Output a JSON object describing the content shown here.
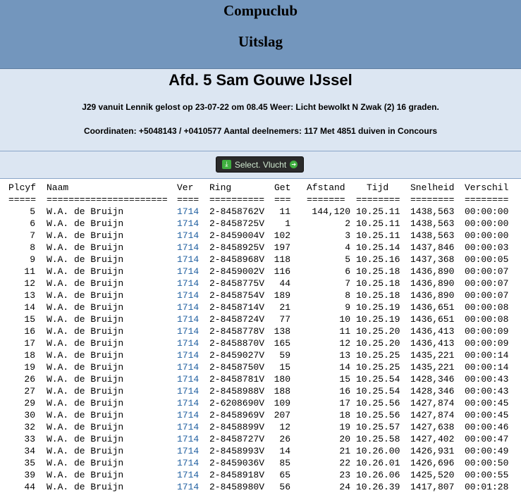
{
  "header": {
    "club": "Compuclub",
    "subtitle": "Uitslag"
  },
  "info": {
    "afdeling": "Afd. 5 Sam Gouwe IJssel",
    "line1": "J29 vanuit Lennik gelost op 23-07-22 om 08.45 Weer: Licht bewolkt N Zwak (2) 16 graden.",
    "line2": "Coordinaten: +5048143 / +0410577 Aantal deelnemers: 117 Met 4851 duiven in Concours"
  },
  "select_button": {
    "label": "Select. Vlucht"
  },
  "table": {
    "headers": {
      "plcyf": "Plcyf",
      "naam": "Naam",
      "ver": "Ver",
      "ring": "Ring",
      "get": "Get",
      "afstand": "Afstand",
      "tijd": "Tijd",
      "snelheid": "Snelheid",
      "verschil": "Verschil"
    },
    "separators": {
      "plcyf": "=====",
      "naam": "======================",
      "ver": "====",
      "ring": "==========",
      "get": "===",
      "afstand": "=======",
      "tijd": "========",
      "snelheid": "========",
      "verschil": "========"
    },
    "rows": [
      {
        "pl": "5",
        "naam": "W.A. de Bruijn",
        "ver": "1714",
        "ring": "2-8458762V",
        "get": "11",
        "afs": "144,120",
        "tijd": "10.25.11",
        "snel": "1438,563",
        "vers": "00:00:00"
      },
      {
        "pl": "6",
        "naam": "W.A. de Bruijn",
        "ver": "1714",
        "ring": "2-8458725V",
        "get": "1",
        "afs": "2",
        "tijd": "10.25.11",
        "snel": "1438,563",
        "vers": "00:00:00"
      },
      {
        "pl": "7",
        "naam": "W.A. de Bruijn",
        "ver": "1714",
        "ring": "2-8459004V",
        "get": "102",
        "afs": "3",
        "tijd": "10.25.11",
        "snel": "1438,563",
        "vers": "00:00:00"
      },
      {
        "pl": "8",
        "naam": "W.A. de Bruijn",
        "ver": "1714",
        "ring": "2-8458925V",
        "get": "197",
        "afs": "4",
        "tijd": "10.25.14",
        "snel": "1437,846",
        "vers": "00:00:03"
      },
      {
        "pl": "9",
        "naam": "W.A. de Bruijn",
        "ver": "1714",
        "ring": "2-8458968V",
        "get": "118",
        "afs": "5",
        "tijd": "10.25.16",
        "snel": "1437,368",
        "vers": "00:00:05"
      },
      {
        "pl": "11",
        "naam": "W.A. de Bruijn",
        "ver": "1714",
        "ring": "2-8459002V",
        "get": "116",
        "afs": "6",
        "tijd": "10.25.18",
        "snel": "1436,890",
        "vers": "00:00:07"
      },
      {
        "pl": "12",
        "naam": "W.A. de Bruijn",
        "ver": "1714",
        "ring": "2-8458775V",
        "get": "44",
        "afs": "7",
        "tijd": "10.25.18",
        "snel": "1436,890",
        "vers": "00:00:07"
      },
      {
        "pl": "13",
        "naam": "W.A. de Bruijn",
        "ver": "1714",
        "ring": "2-8458754V",
        "get": "189",
        "afs": "8",
        "tijd": "10.25.18",
        "snel": "1436,890",
        "vers": "00:00:07"
      },
      {
        "pl": "14",
        "naam": "W.A. de Bruijn",
        "ver": "1714",
        "ring": "2-8458714V",
        "get": "21",
        "afs": "9",
        "tijd": "10.25.19",
        "snel": "1436,651",
        "vers": "00:00:08"
      },
      {
        "pl": "15",
        "naam": "W.A. de Bruijn",
        "ver": "1714",
        "ring": "2-8458724V",
        "get": "77",
        "afs": "10",
        "tijd": "10.25.19",
        "snel": "1436,651",
        "vers": "00:00:08"
      },
      {
        "pl": "16",
        "naam": "W.A. de Bruijn",
        "ver": "1714",
        "ring": "2-8458778V",
        "get": "138",
        "afs": "11",
        "tijd": "10.25.20",
        "snel": "1436,413",
        "vers": "00:00:09"
      },
      {
        "pl": "17",
        "naam": "W.A. de Bruijn",
        "ver": "1714",
        "ring": "2-8458870V",
        "get": "165",
        "afs": "12",
        "tijd": "10.25.20",
        "snel": "1436,413",
        "vers": "00:00:09"
      },
      {
        "pl": "18",
        "naam": "W.A. de Bruijn",
        "ver": "1714",
        "ring": "2-8459027V",
        "get": "59",
        "afs": "13",
        "tijd": "10.25.25",
        "snel": "1435,221",
        "vers": "00:00:14"
      },
      {
        "pl": "19",
        "naam": "W.A. de Bruijn",
        "ver": "1714",
        "ring": "2-8458750V",
        "get": "15",
        "afs": "14",
        "tijd": "10.25.25",
        "snel": "1435,221",
        "vers": "00:00:14"
      },
      {
        "pl": "26",
        "naam": "W.A. de Bruijn",
        "ver": "1714",
        "ring": "2-8458781V",
        "get": "180",
        "afs": "15",
        "tijd": "10.25.54",
        "snel": "1428,346",
        "vers": "00:00:43"
      },
      {
        "pl": "27",
        "naam": "W.A. de Bruijn",
        "ver": "1714",
        "ring": "2-8458988V",
        "get": "188",
        "afs": "16",
        "tijd": "10.25.54",
        "snel": "1428,346",
        "vers": "00:00:43"
      },
      {
        "pl": "29",
        "naam": "W.A. de Bruijn",
        "ver": "1714",
        "ring": "2-6208690V",
        "get": "109",
        "afs": "17",
        "tijd": "10.25.56",
        "snel": "1427,874",
        "vers": "00:00:45"
      },
      {
        "pl": "30",
        "naam": "W.A. de Bruijn",
        "ver": "1714",
        "ring": "2-8458969V",
        "get": "207",
        "afs": "18",
        "tijd": "10.25.56",
        "snel": "1427,874",
        "vers": "00:00:45"
      },
      {
        "pl": "32",
        "naam": "W.A. de Bruijn",
        "ver": "1714",
        "ring": "2-8458899V",
        "get": "12",
        "afs": "19",
        "tijd": "10.25.57",
        "snel": "1427,638",
        "vers": "00:00:46"
      },
      {
        "pl": "33",
        "naam": "W.A. de Bruijn",
        "ver": "1714",
        "ring": "2-8458727V",
        "get": "26",
        "afs": "20",
        "tijd": "10.25.58",
        "snel": "1427,402",
        "vers": "00:00:47"
      },
      {
        "pl": "34",
        "naam": "W.A. de Bruijn",
        "ver": "1714",
        "ring": "2-8458993V",
        "get": "14",
        "afs": "21",
        "tijd": "10.26.00",
        "snel": "1426,931",
        "vers": "00:00:49"
      },
      {
        "pl": "35",
        "naam": "W.A. de Bruijn",
        "ver": "1714",
        "ring": "2-8459036V",
        "get": "85",
        "afs": "22",
        "tijd": "10.26.01",
        "snel": "1426,696",
        "vers": "00:00:50"
      },
      {
        "pl": "39",
        "naam": "W.A. de Bruijn",
        "ver": "1714",
        "ring": "2-8458918V",
        "get": "65",
        "afs": "23",
        "tijd": "10.26.06",
        "snel": "1425,520",
        "vers": "00:00:55"
      },
      {
        "pl": "44",
        "naam": "W.A. de Bruijn",
        "ver": "1714",
        "ring": "2-8458980V",
        "get": "56",
        "afs": "24",
        "tijd": "10.26.39",
        "snel": "1417,807",
        "vers": "00:01:28"
      }
    ]
  }
}
